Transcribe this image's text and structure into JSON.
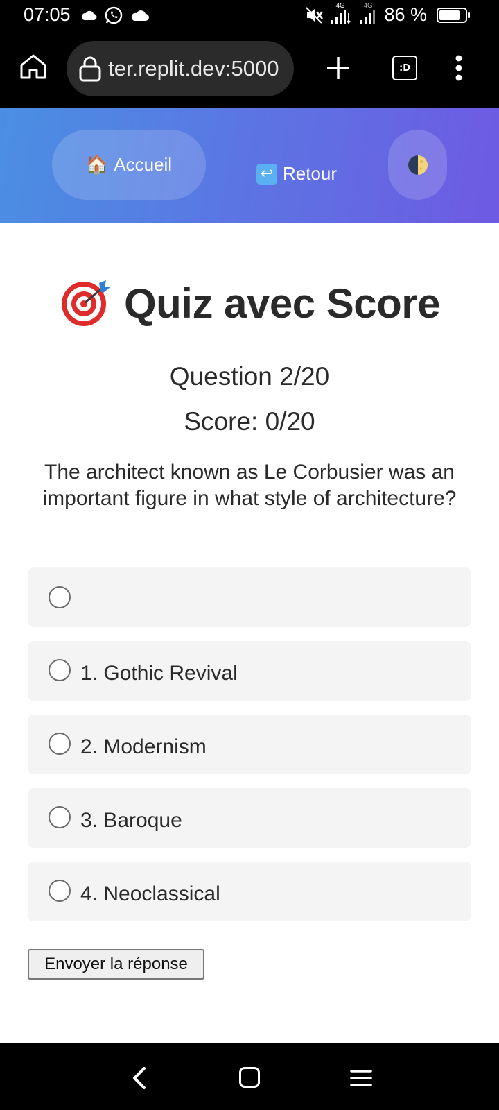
{
  "status_bar": {
    "time": "07:05",
    "battery_percent": "86 %",
    "battery_level": 0.86,
    "network_labels": [
      "4G",
      "4G"
    ],
    "icons": [
      "cloud-icon",
      "whatsapp-icon",
      "cloud-icon",
      "muted-icon",
      "signal-icon",
      "signal-icon",
      "battery-icon"
    ]
  },
  "browser": {
    "url": "ter.replit.dev:5000",
    "tabs_label": ":D",
    "icons": [
      "home-icon",
      "lock-icon",
      "plus-icon",
      "tabs-icon",
      "overflow-menu-icon"
    ]
  },
  "header": {
    "home_emoji": "🏠",
    "home_label": "Accueil",
    "back_emoji": "↩",
    "back_label": "Retour",
    "theme_icon": "half-moon-icon",
    "colors": {
      "gradient_start": "#4a8fe3",
      "gradient_end": "#6e5ae3"
    }
  },
  "quiz": {
    "title_emoji": "🎯",
    "title": "Quiz avec Score",
    "question_counter": "Question 2/20",
    "score": "Score: 0/20",
    "question": "The architect known as Le Corbusier was an important figure in what style of architecture?",
    "options": [
      {
        "label": ""
      },
      {
        "label": "1. Gothic Revival"
      },
      {
        "label": "2. Modernism"
      },
      {
        "label": "3. Baroque"
      },
      {
        "label": "4. Neoclassical"
      }
    ],
    "submit_label": "Envoyer la réponse"
  },
  "nav_bar": {
    "icons": [
      "back-icon",
      "home-icon",
      "recents-icon"
    ]
  }
}
